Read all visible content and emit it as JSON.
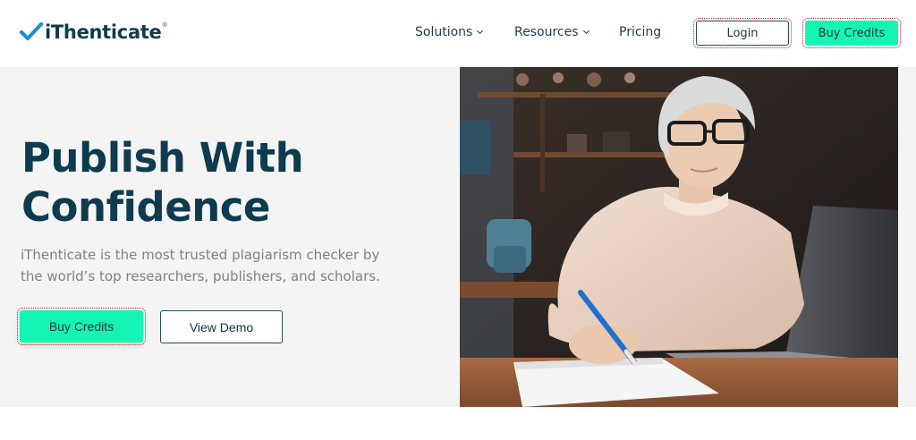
{
  "brand": {
    "name": "iThenticate",
    "tm": "®",
    "accent": "#1a8fd8",
    "dark": "#0e3b4e"
  },
  "nav": {
    "items": [
      {
        "label": "Solutions",
        "has_dropdown": true
      },
      {
        "label": "Resources",
        "has_dropdown": true
      },
      {
        "label": "Pricing",
        "has_dropdown": false
      }
    ],
    "login_label": "Login",
    "buy_label": "Buy Credits"
  },
  "hero": {
    "title_line1": "Publish With",
    "title_line2": "Confidence",
    "subtitle": "iThenticate is the most trusted plagiarism checker by the world’s top researchers, publishers, and scholars.",
    "primary_cta": "Buy Credits",
    "secondary_cta": "View Demo",
    "cta_color": "#14f5b3"
  }
}
